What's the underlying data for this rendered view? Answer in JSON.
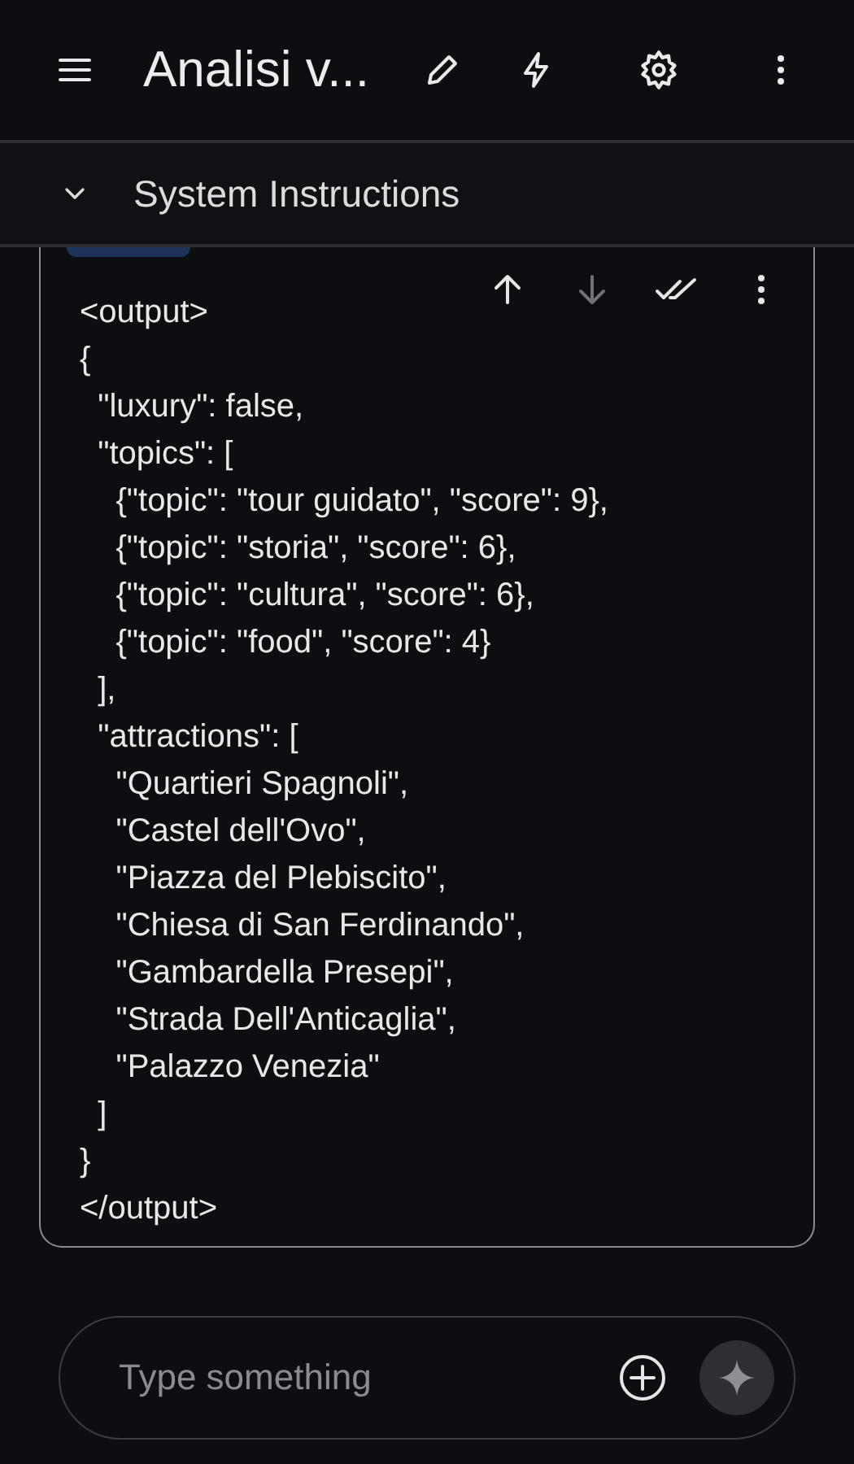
{
  "top_bar": {
    "title": "Analisi v..."
  },
  "section": {
    "title": "System Instructions",
    "expanded": true
  },
  "message": {
    "toolbar": [
      {
        "kind": "up",
        "disabled": false
      },
      {
        "kind": "down",
        "disabled": true
      },
      {
        "kind": "check",
        "disabled": false
      },
      {
        "kind": "more",
        "disabled": false
      }
    ],
    "lines": [
      "<output>",
      "{",
      "  \"luxury\": false,",
      "  \"topics\": [",
      "    {\"topic\": \"tour guidato\", \"score\": 9},",
      "    {\"topic\": \"storia\", \"score\": 6},",
      "    {\"topic\": \"cultura\", \"score\": 6},",
      "    {\"topic\": \"food\", \"score\": 4}",
      "  ],",
      "  \"attractions\": [",
      "    \"Quartieri Spagnoli\",",
      "    \"Castel dell'Ovo\",",
      "    \"Piazza del Plebiscito\",",
      "    \"Chiesa di San Ferdinando\",",
      "    \"Gambardella Presepi\",",
      "    \"Strada Dell'Anticaglia\",",
      "    \"Palazzo Venezia\"",
      "  ]",
      "}",
      "</output>"
    ]
  },
  "composer": {
    "placeholder": "Type something"
  }
}
